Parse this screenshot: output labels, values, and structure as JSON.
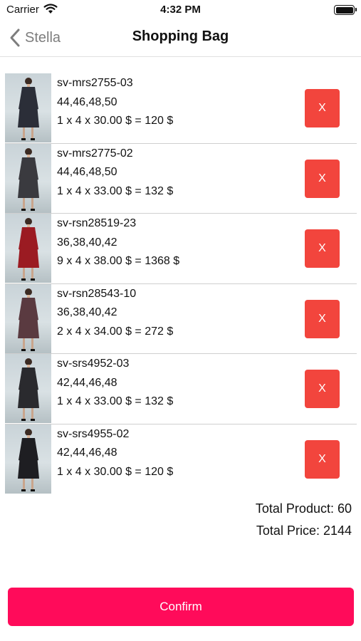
{
  "status_bar": {
    "carrier": "Carrier",
    "time": "4:32 PM"
  },
  "nav": {
    "back_label": "Stella",
    "title": "Shopping Bag"
  },
  "items": [
    {
      "code": "sv-mrs2755-03",
      "sizes": "44,46,48,50",
      "calc": "1 x 4 x 30.00 $ = 120 $",
      "remove_label": "X",
      "dress_color": "#2b2e38"
    },
    {
      "code": "sv-mrs2775-02",
      "sizes": "44,46,48,50",
      "calc": "1 x 4 x 33.00 $ = 132 $",
      "remove_label": "X",
      "dress_color": "#3a3a3f"
    },
    {
      "code": "sv-rsn28519-23",
      "sizes": "36,38,40,42",
      "calc": "9 x 4 x 38.00 $ = 1368 $",
      "remove_label": "X",
      "dress_color": "#9b1b22"
    },
    {
      "code": "sv-rsn28543-10",
      "sizes": "36,38,40,42",
      "calc": "2 x 4 x 34.00 $ = 272 $",
      "remove_label": "X",
      "dress_color": "#5a3a40"
    },
    {
      "code": "sv-srs4952-03",
      "sizes": "42,44,46,48",
      "calc": "1 x 4 x 33.00 $ = 132 $",
      "remove_label": "X",
      "dress_color": "#2a2a2e"
    },
    {
      "code": "sv-srs4955-02",
      "sizes": "42,44,46,48",
      "calc": "1 x 4 x 30.00 $ = 120 $",
      "remove_label": "X",
      "dress_color": "#1e1e22"
    }
  ],
  "totals": {
    "product_line": "Total Product: 60",
    "price_line": "Total Price: 2144"
  },
  "confirm_label": "Confirm",
  "colors": {
    "remove": "#f2453d",
    "confirm": "#ff0b5a",
    "back": "#7d7d7d"
  }
}
